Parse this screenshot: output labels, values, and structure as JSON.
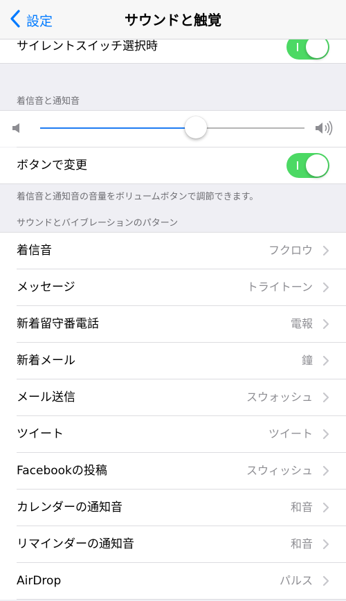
{
  "nav": {
    "back_label": "設定",
    "title": "サウンドと触覚"
  },
  "silent_switch": {
    "label": "サイレントスイッチ選択時",
    "enabled": true
  },
  "ringer_section": {
    "header": "着信音と通知音",
    "volume_fraction": 0.59,
    "change_with_buttons_label": "ボタンで変更",
    "change_with_buttons_enabled": true,
    "footer": "着信音と通知音の音量をボリュームボタンで調節できます。"
  },
  "patterns_section": {
    "header": "サウンドとバイブレーションのパターン",
    "items": [
      {
        "label": "着信音",
        "value": "フクロウ"
      },
      {
        "label": "メッセージ",
        "value": "トライトーン"
      },
      {
        "label": "新着留守番電話",
        "value": "電報"
      },
      {
        "label": "新着メール",
        "value": "鐘"
      },
      {
        "label": "メール送信",
        "value": "スウォッシュ"
      },
      {
        "label": "ツイート",
        "value": "ツイート"
      },
      {
        "label": "Facebookの投稿",
        "value": "スウィッシュ"
      },
      {
        "label": "カレンダーの通知音",
        "value": "和音"
      },
      {
        "label": "リマインダーの通知音",
        "value": "和音"
      },
      {
        "label": "AirDrop",
        "value": "パルス"
      }
    ]
  },
  "colors": {
    "accent": "#007aff",
    "toggle_on": "#4cd964",
    "slider_fill": "#1e7cf2"
  }
}
